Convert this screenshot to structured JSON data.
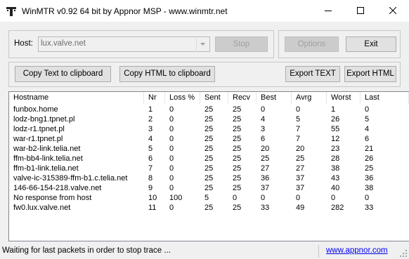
{
  "window": {
    "title": "WinMTR v0.92 64 bit by Appnor MSP - www.winmtr.net",
    "icon": "winmtr-app-icon",
    "controls": [
      "minimize-icon",
      "maximize-icon",
      "close-icon"
    ]
  },
  "host": {
    "label": "Host:",
    "value": "lux.valve.net"
  },
  "buttons": {
    "stop": "Stop",
    "options": "Options",
    "exit": "Exit",
    "copy_text": "Copy Text to clipboard",
    "copy_html": "Copy HTML to clipboard",
    "export_text": "Export TEXT",
    "export_html": "Export HTML"
  },
  "table": {
    "columns": [
      "Hostname",
      "Nr",
      "Loss %",
      "Sent",
      "Recv",
      "Best",
      "Avrg",
      "Worst",
      "Last"
    ],
    "rows": [
      [
        "funbox.home",
        "1",
        "0",
        "25",
        "25",
        "0",
        "0",
        "1",
        "0"
      ],
      [
        "lodz-bng1.tpnet.pl",
        "2",
        "0",
        "25",
        "25",
        "4",
        "5",
        "26",
        "5"
      ],
      [
        "lodz-r1.tpnet.pl",
        "3",
        "0",
        "25",
        "25",
        "3",
        "7",
        "55",
        "4"
      ],
      [
        "war-r1.tpnet.pl",
        "4",
        "0",
        "25",
        "25",
        "6",
        "7",
        "12",
        "6"
      ],
      [
        "war-b2-link.telia.net",
        "5",
        "0",
        "25",
        "25",
        "20",
        "20",
        "23",
        "21"
      ],
      [
        "ffm-bb4-link.telia.net",
        "6",
        "0",
        "25",
        "25",
        "25",
        "25",
        "28",
        "26"
      ],
      [
        "ffm-b1-link.telia.net",
        "7",
        "0",
        "25",
        "25",
        "27",
        "27",
        "38",
        "25"
      ],
      [
        "valve-ic-315389-ffm-b1.c.telia.net",
        "8",
        "0",
        "25",
        "25",
        "36",
        "37",
        "43",
        "36"
      ],
      [
        "146-66-154-218.valve.net",
        "9",
        "0",
        "25",
        "25",
        "37",
        "37",
        "40",
        "38"
      ],
      [
        "No response from host",
        "10",
        "100",
        "5",
        "0",
        "0",
        "0",
        "0",
        "0"
      ],
      [
        "fw0.lux.valve.net",
        "11",
        "0",
        "25",
        "25",
        "33",
        "49",
        "282",
        "33"
      ]
    ]
  },
  "status": {
    "message": "Waiting for last packets in order to stop trace ...",
    "link": "www.appnor.com"
  }
}
